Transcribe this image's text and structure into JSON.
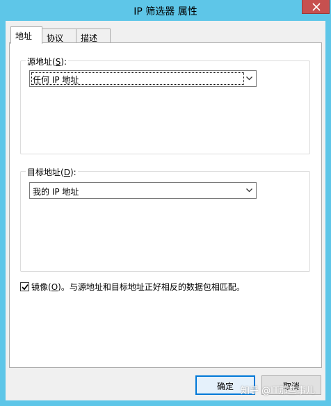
{
  "window": {
    "title": "IP 筛选器 属性"
  },
  "tabs": [
    {
      "label": "地址",
      "active": true
    },
    {
      "label": "协议",
      "active": false
    },
    {
      "label": "描述",
      "active": false
    }
  ],
  "source": {
    "label_prefix": "源地址(",
    "label_key": "S",
    "label_suffix": "):",
    "selected": "任何 IP 地址"
  },
  "destination": {
    "label_prefix": "目标地址(",
    "label_key": "D",
    "label_suffix": "):",
    "selected": "我的 IP 地址"
  },
  "mirror": {
    "checked": true,
    "label_prefix": "镜像(",
    "label_key": "O",
    "label_suffix": ")。与源地址和目标地址正好相反的数据包相匹配。"
  },
  "buttons": {
    "ok": "确定",
    "cancel": "取消"
  },
  "watermark": "知乎 @IT那些事儿",
  "colors": {
    "titlebar": "#5ec6e8",
    "close_button": "#c7504f",
    "accent": "#0078d7"
  }
}
